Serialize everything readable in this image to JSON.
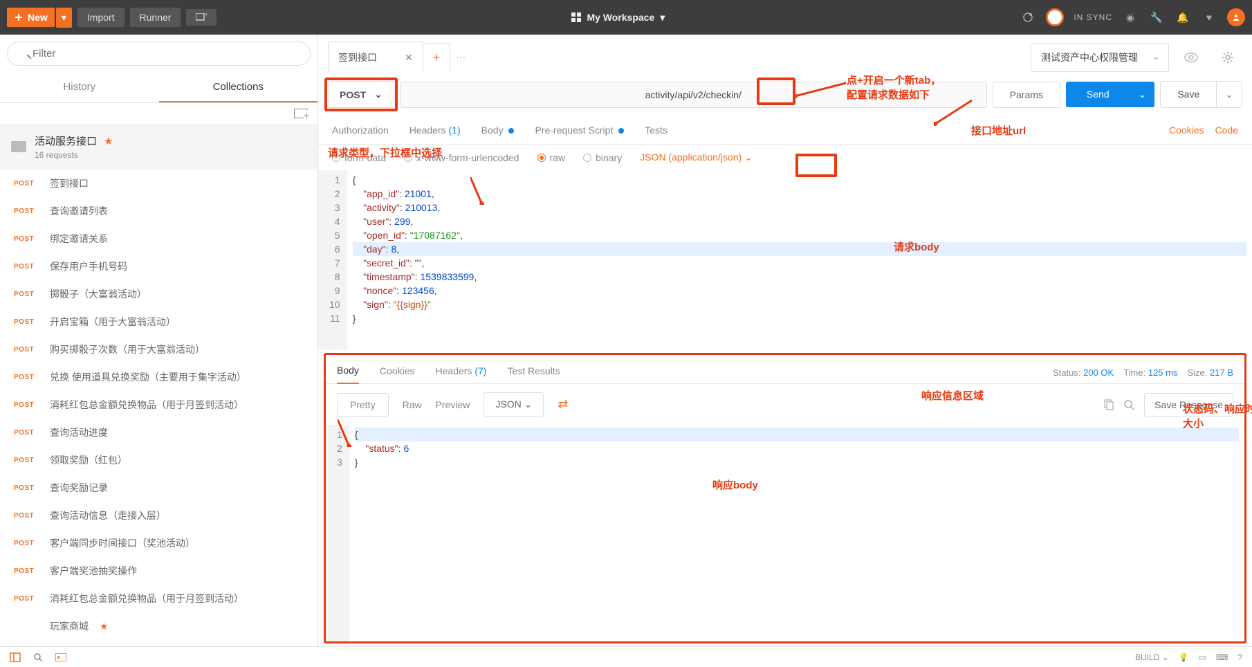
{
  "header": {
    "new": "New",
    "import": "Import",
    "runner": "Runner",
    "workspace": "My Workspace",
    "sync_status": "IN SYNC"
  },
  "sidebar": {
    "filter_placeholder": "Filter",
    "tabs": {
      "history": "History",
      "collections": "Collections"
    },
    "collection": {
      "name": "活动服务接口",
      "requests_count": "16 requests"
    },
    "items": [
      {
        "method": "POST",
        "name": "签到接口"
      },
      {
        "method": "POST",
        "name": "查询邀请列表"
      },
      {
        "method": "POST",
        "name": "绑定邀请关系"
      },
      {
        "method": "POST",
        "name": "保存用户手机号码"
      },
      {
        "method": "POST",
        "name": "掷骰子（大富翁活动）"
      },
      {
        "method": "POST",
        "name": "开启宝箱（用于大富翁活动）"
      },
      {
        "method": "POST",
        "name": "购买掷骰子次数（用于大富翁活动）"
      },
      {
        "method": "POST",
        "name": "兑换 使用道具兑换奖励（主要用于集字活动）"
      },
      {
        "method": "POST",
        "name": "消耗红包总金额兑换物品（用于月签到活动）"
      },
      {
        "method": "POST",
        "name": "查询活动进度"
      },
      {
        "method": "POST",
        "name": "领取奖励（红包）"
      },
      {
        "method": "POST",
        "name": "查询奖励记录"
      },
      {
        "method": "POST",
        "name": "查询活动信息（走接入层）"
      },
      {
        "method": "POST",
        "name": "客户端同步时间接口（奖池活动）"
      },
      {
        "method": "POST",
        "name": "客户端奖池抽奖操作"
      },
      {
        "method": "POST",
        "name": "消耗红包总金额兑换物品（用于月签到活动）"
      },
      {
        "method": "",
        "name": "玩家商城",
        "starred": true
      }
    ]
  },
  "request": {
    "tab_name": "签到接口",
    "method": "POST",
    "url": "activity/api/v2/checkin/",
    "params_label": "Params",
    "send_label": "Send",
    "save_label": "Save",
    "environment": "测试资产中心权限管理"
  },
  "subtabs": {
    "authorization": "Authorization",
    "headers": "Headers",
    "headers_count": "(1)",
    "body": "Body",
    "prerequest": "Pre-request Script",
    "tests": "Tests",
    "cookies": "Cookies",
    "code": "Code"
  },
  "body_opts": {
    "formdata": "form-data",
    "urlencoded": "x-www-form-urlencoded",
    "raw": "raw",
    "binary": "binary",
    "format": "JSON (application/json)"
  },
  "request_body_lines": [
    "{",
    "    \"app_id\": 21001,",
    "    \"activity\": 210013,",
    "    \"user\": 299,",
    "    \"open_id\":\"17087162\",",
    "    \"day\": 8,",
    "    \"secret_id\":\"\",",
    "    \"timestamp\":1539833599,",
    "    \"nonce\":123456,",
    "    \"sign\":\"{{sign}}\"",
    "}"
  ],
  "response_tabs": {
    "body": "Body",
    "cookies": "Cookies",
    "headers": "Headers",
    "headers_count": "(7)",
    "tests": "Test Results"
  },
  "response_status": {
    "status_label": "Status:",
    "status": "200 OK",
    "time_label": "Time:",
    "time": "125 ms",
    "size_label": "Size:",
    "size": "217 B"
  },
  "response_toolbar": {
    "pretty": "Pretty",
    "raw": "Raw",
    "preview": "Preview",
    "json": "JSON",
    "save_response": "Save Response"
  },
  "response_body_lines": [
    "{",
    "    \"status\": 6",
    "}"
  ],
  "footer": {
    "build": "BUILD"
  },
  "annotations": {
    "new_tab": "点+开启一个新tab，\n配置请求数据如下",
    "url": "接口地址url",
    "method": "请求类型，下拉框中选择",
    "body": "请求body",
    "resp_area": "响应信息区域",
    "resp_stat": "状态码、响应时间、包大小",
    "resp_body": "响应body"
  }
}
